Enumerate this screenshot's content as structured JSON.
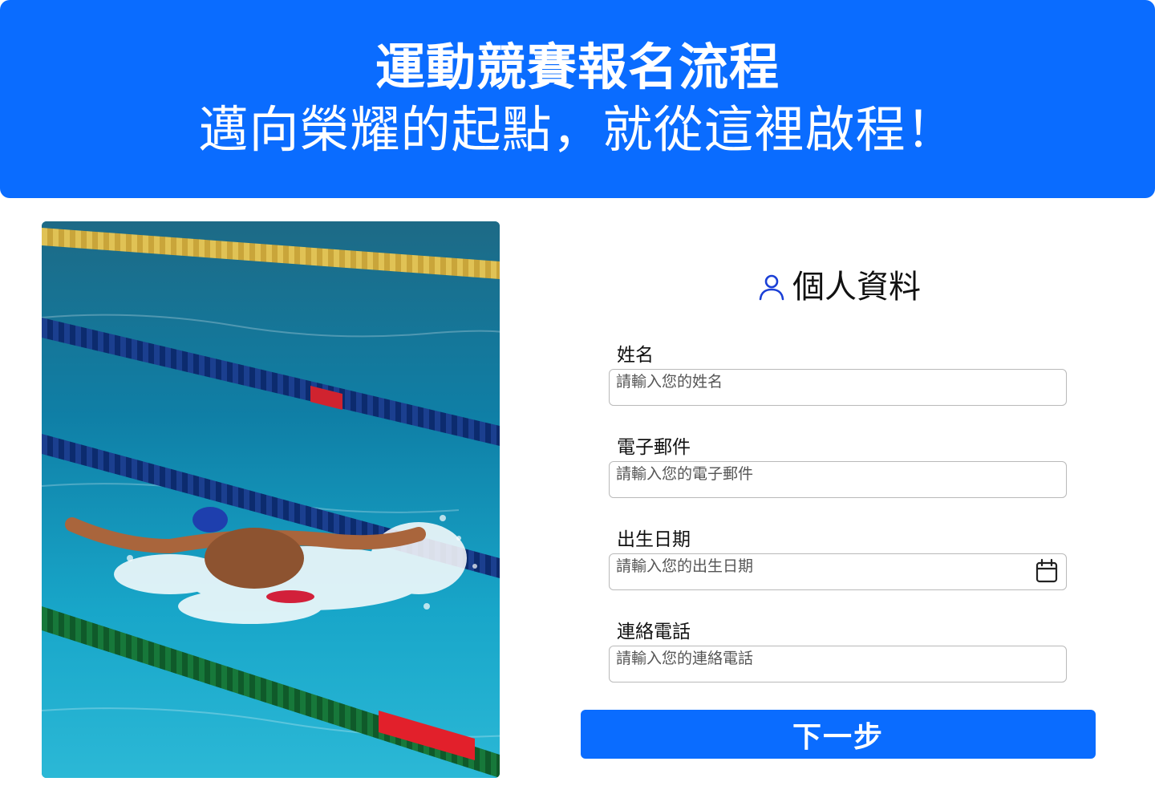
{
  "hero": {
    "title": "運動競賽報名流程",
    "subtitle": "邁向榮耀的起點，就從這裡啟程！",
    "background_color": "#0a6cff"
  },
  "photo": {
    "subject": "swimmer-butterfly-stroke-in-pool"
  },
  "form": {
    "title": "個人資料",
    "title_icon": "user-icon",
    "fields": [
      {
        "label": "姓名",
        "placeholder": "請輸入您的姓名",
        "value": ""
      },
      {
        "label": "電子郵件",
        "placeholder": "請輸入您的電子郵件",
        "value": ""
      },
      {
        "label": "出生日期",
        "placeholder": "請輸入您的出生日期",
        "value": "",
        "icon": "calendar-icon"
      },
      {
        "label": "連絡電話",
        "placeholder": "請輸入您的連絡電話",
        "value": ""
      }
    ],
    "next_label": "下一步",
    "accent_color": "#0a6cff"
  }
}
